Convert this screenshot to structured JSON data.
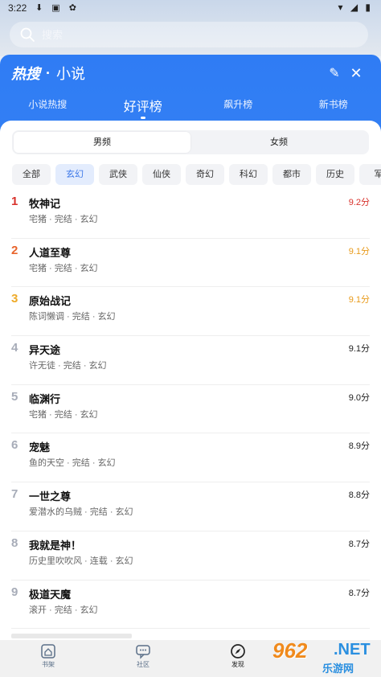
{
  "status": {
    "time": "3:22",
    "left_icons": "⬇ ▣ ✿",
    "right_icons": "▾ ◢ ▮"
  },
  "search": {
    "placeholder": "搜索"
  },
  "panel": {
    "brand": "热搜",
    "dot": "·",
    "title": "小说",
    "edit_icon": "✎",
    "close_icon": "✕"
  },
  "tabs": [
    {
      "label": "小说热搜",
      "active": false
    },
    {
      "label": "好评榜",
      "active": true
    },
    {
      "label": "飙升榜",
      "active": false
    },
    {
      "label": "新书榜",
      "active": false
    }
  ],
  "gender": [
    {
      "label": "男频",
      "active": true
    },
    {
      "label": "女频",
      "active": false
    }
  ],
  "categories": [
    {
      "label": "全部",
      "active": false
    },
    {
      "label": "玄幻",
      "active": true
    },
    {
      "label": "武侠",
      "active": false
    },
    {
      "label": "仙侠",
      "active": false
    },
    {
      "label": "奇幻",
      "active": false
    },
    {
      "label": "科幻",
      "active": false
    },
    {
      "label": "都市",
      "active": false
    },
    {
      "label": "历史",
      "active": false
    },
    {
      "label": "军",
      "active": false
    }
  ],
  "books": [
    {
      "rank": "1",
      "name": "牧神记",
      "meta": "宅猪 · 完结 · 玄幻",
      "score": "9.2分"
    },
    {
      "rank": "2",
      "name": "人道至尊",
      "meta": "宅猪 · 完结 · 玄幻",
      "score": "9.1分"
    },
    {
      "rank": "3",
      "name": "原始战记",
      "meta": "陈词懒调 · 完结 · 玄幻",
      "score": "9.1分"
    },
    {
      "rank": "4",
      "name": "异天途",
      "meta": "许无徒 · 完结 · 玄幻",
      "score": "9.1分"
    },
    {
      "rank": "5",
      "name": "临渊行",
      "meta": "宅猪 · 完结 · 玄幻",
      "score": "9.0分"
    },
    {
      "rank": "6",
      "name": "宠魅",
      "meta": "鱼的天空 · 完结 · 玄幻",
      "score": "8.9分"
    },
    {
      "rank": "7",
      "name": "一世之尊",
      "meta": "爱潜水的乌贼 · 完结 · 玄幻",
      "score": "8.8分"
    },
    {
      "rank": "8",
      "name": "我就是神！",
      "meta": "历史里吹吹风 · 连载 · 玄幻",
      "score": "8.7分"
    },
    {
      "rank": "9",
      "name": "极道天魔",
      "meta": "滚开 · 完结 · 玄幻",
      "score": "8.7分"
    }
  ],
  "nav": {
    "shelf": "书架",
    "community": "社区",
    "discover": "发现"
  },
  "watermark": {
    "num": "962",
    "net": ".NET",
    "sub": "乐游网"
  },
  "colors": {
    "accent_blue": "#2f7cf4",
    "rank1": "#d8312b",
    "rank2": "#e8642c",
    "rank3": "#eeaa28"
  }
}
